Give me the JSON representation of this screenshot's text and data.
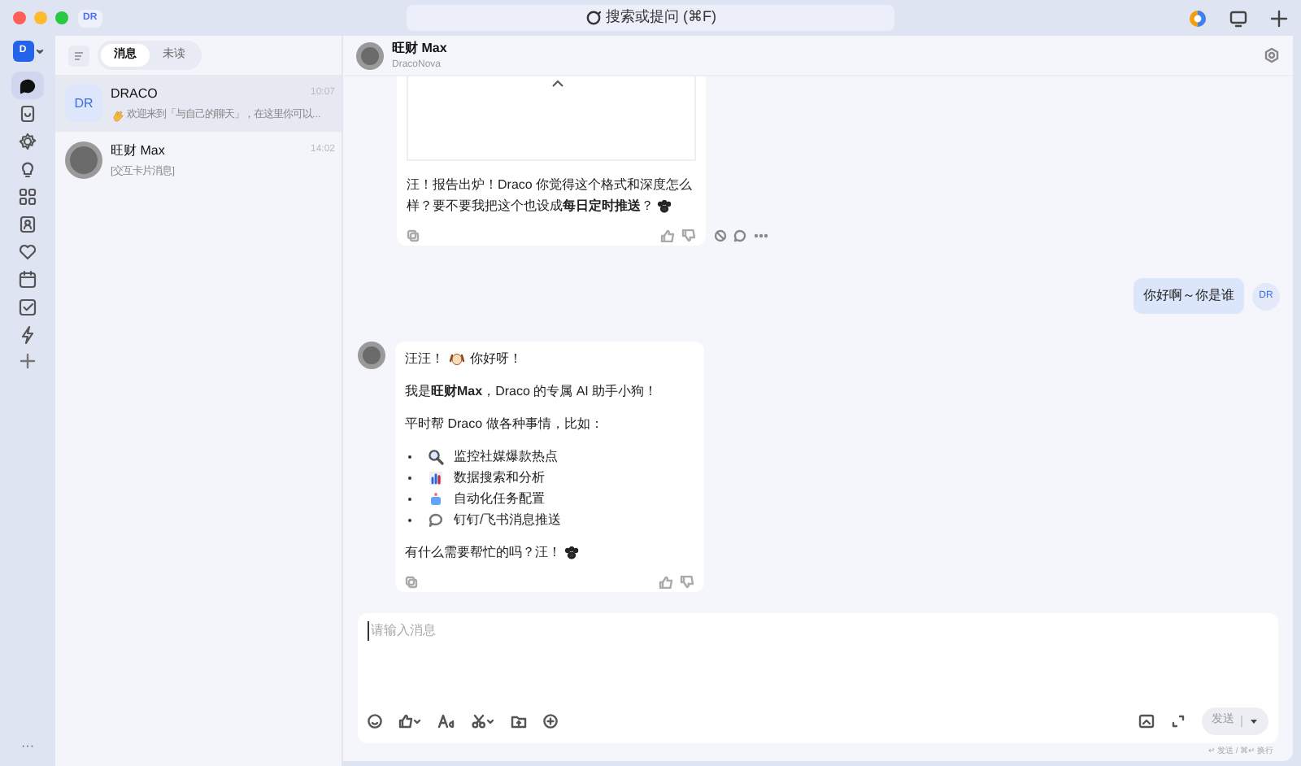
{
  "titlebar": {
    "tab": "DR",
    "search": "搜索或提问 (⌘F)"
  },
  "rail": {
    "avatar": "D",
    "items": [
      {
        "selected": true
      },
      {
        "selected": false
      },
      {
        "selected": false
      },
      {
        "selected": false
      },
      {
        "selected": false
      },
      {
        "selected": false
      },
      {
        "selected": false
      },
      {
        "selected": false
      },
      {
        "selected": false
      },
      {
        "selected": false
      }
    ],
    "more": "···"
  },
  "chat_list": {
    "tabs": [
      {
        "label": "消息",
        "selected": true
      },
      {
        "label": "未读",
        "selected": false
      }
    ],
    "items": [
      {
        "kind": "initials",
        "avatar": "DR",
        "name": "DRACO",
        "preview": "欢迎来到「与自己的聊天」，在这里你可以...",
        "time": "10:07",
        "selected": true
      },
      {
        "kind": "photo",
        "name": "旺财 Max",
        "preview": "[交互卡片消息]",
        "time": "14:02",
        "selected": false
      }
    ]
  },
  "conversation": {
    "title": "旺财 Max",
    "subtitle": "DracoNova",
    "messages": [
      {
        "kind": "bot_partial",
        "paragraphs": [
          "汪！报告出炉！Draco 你觉得这个格式和深度怎么样？要不要我把这个也设成**每日定时推送**？"
        ]
      },
      {
        "kind": "user",
        "avatar": "DR",
        "text": "你好啊～你是谁"
      },
      {
        "kind": "bot",
        "paragraphs": [
          "汪汪！",
          "你好呀！"
        ],
        "intro": [
          "我是**旺财Max**，Draco 的专属 AI 助手小狗！",
          "平时帮 Draco 做各种事情，比如："
        ],
        "bullets": [
          "监控社媒爆款热点",
          "数据搜索和分析",
          "自动化任务配置",
          "钉钉/飞书消息推送"
        ],
        "outro": "有什么需要帮忙的吗？汪！"
      }
    ]
  },
  "composer": {
    "placeholder": "请输入消息",
    "send": "发送",
    "hint": "↵ 发送 / ⌘↵ 换行"
  }
}
